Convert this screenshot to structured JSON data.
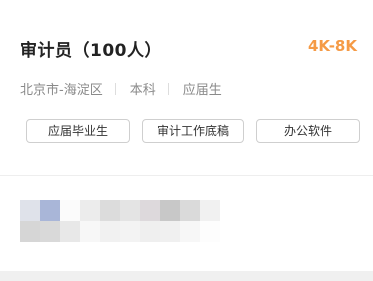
{
  "job": {
    "title": "审计员（100人）",
    "salary": "4K-8K",
    "location": "北京市-海淀区",
    "education": "本科",
    "experience": "应届生"
  },
  "tags": [
    "应届毕业生",
    "审计工作底稿",
    "办公软件"
  ],
  "colors": {
    "salary": "#f59a45",
    "title": "#222222",
    "meta": "#8a8a8a",
    "tag_border": "#cfcfcf"
  }
}
